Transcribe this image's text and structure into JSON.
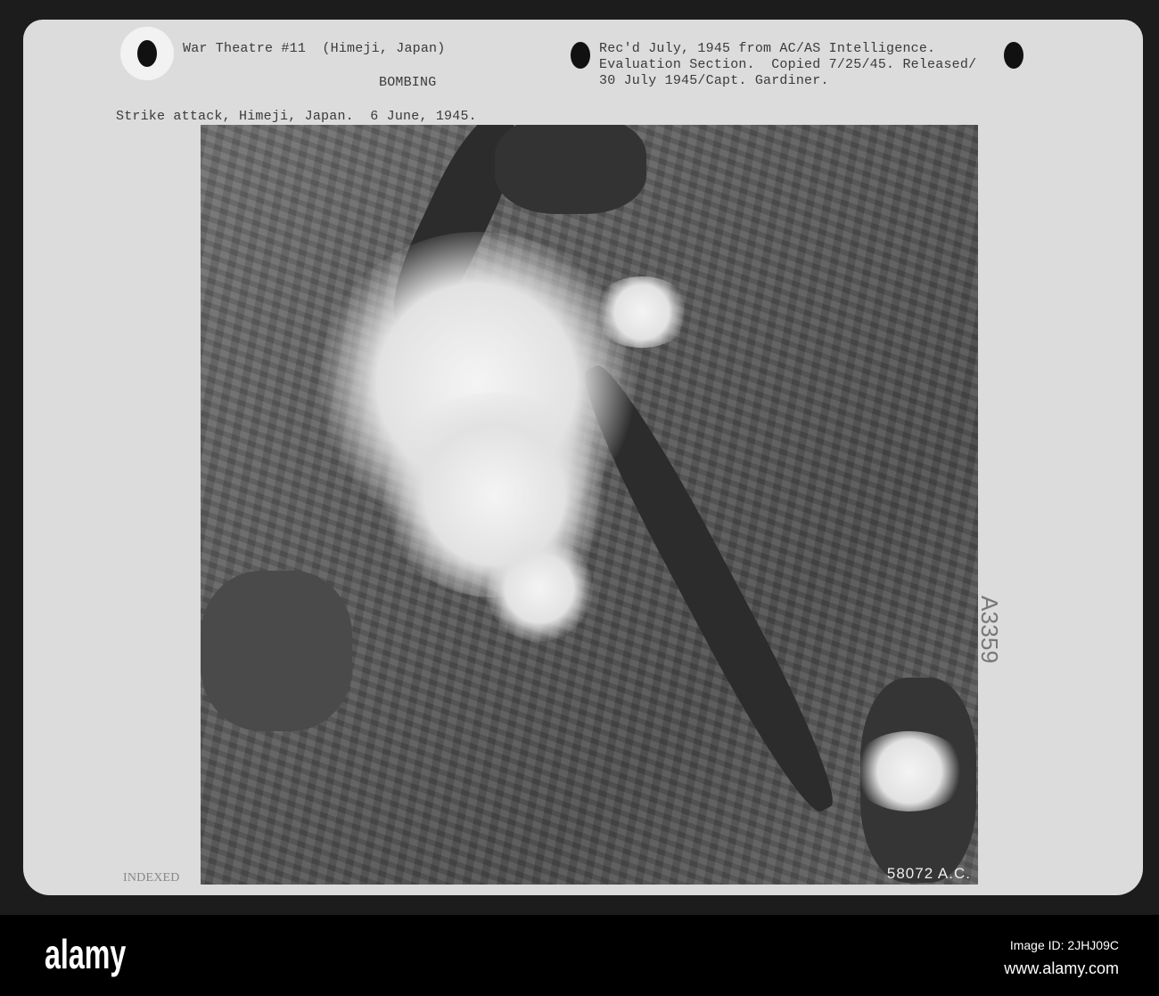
{
  "header": {
    "left_line": "War Theatre #11  (Himeji, Japan)",
    "category": "BOMBING",
    "caption": "Strike attack, Himeji, Japan.  6 June, 1945.",
    "right_lines": [
      "Rec'd July, 1945 from AC/AS Intelligence.",
      "Evaluation Section.  Copied 7/25/45. Released/",
      "30 July 1945/Capt. Gardiner."
    ]
  },
  "side_note": "A3359",
  "indexed_stamp": "INDEXED",
  "photo_number": "58072 A.C.",
  "footer": {
    "logo": "alamy",
    "image_id": "Image ID: 2JHJ09C",
    "url": "www.alamy.com"
  }
}
